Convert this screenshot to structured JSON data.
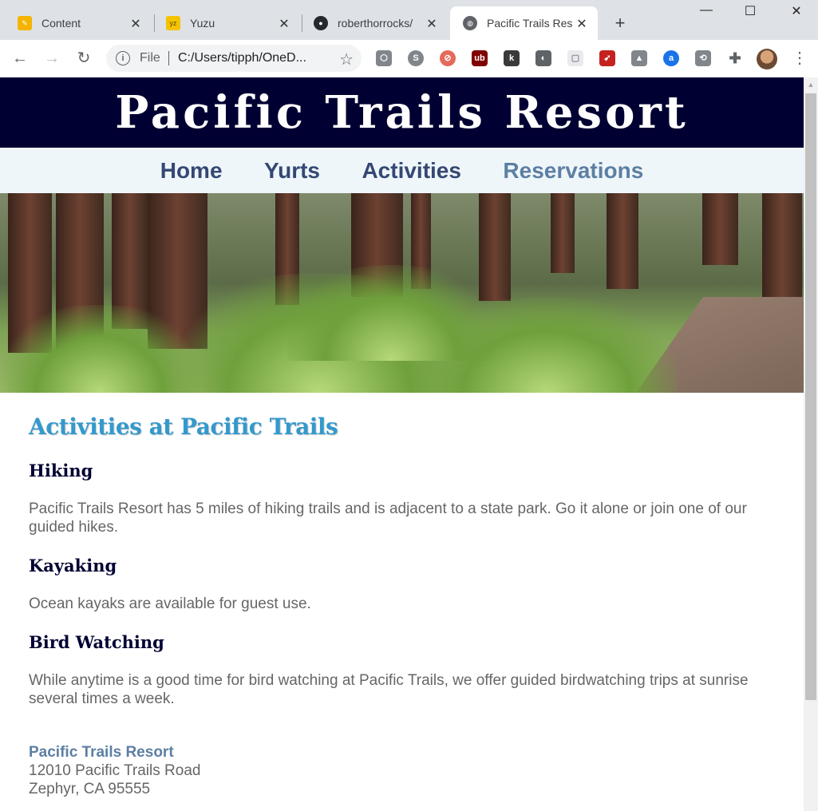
{
  "browser": {
    "tabs": [
      {
        "title": "Content",
        "favicon": "pencil-icon"
      },
      {
        "title": "Yuzu",
        "favicon": "yuzu-icon"
      },
      {
        "title": "roberthorrocks/",
        "favicon": "github-icon"
      },
      {
        "title": "Pacific Trails Res",
        "favicon": "globe-icon",
        "active": true
      }
    ],
    "omnibox": {
      "scheme_label": "File",
      "url": "C:/Users/tipph/OneD..."
    }
  },
  "site": {
    "title": "Pacific Trails Resort",
    "nav": [
      "Home",
      "Yurts",
      "Activities",
      "Reservations"
    ],
    "nav_current_index": 3
  },
  "main": {
    "heading": "Activities at Pacific Trails",
    "sections": [
      {
        "title": "Hiking",
        "text": "Pacific Trails Resort has 5 miles of hiking trails and is adjacent to a state park. Go it alone or join one of our guided hikes."
      },
      {
        "title": "Kayaking",
        "text": "Ocean kayaks are available for guest use."
      },
      {
        "title": "Bird Watching",
        "text": "While anytime is a good time for bird watching at Pacific Trails, we offer guided birdwatching trips at sunrise several times a week."
      }
    ]
  },
  "footer": {
    "name": "Pacific Trails Resort",
    "street": "12010 Pacific Trails Road",
    "city": "Zephyr, CA 95555"
  },
  "colors": {
    "header_bg": "#000033",
    "nav_bg": "#eff6fa",
    "nav_link": "#344873",
    "nav_current": "#5c7fa3",
    "heading": "#3399cc",
    "subheading": "#000033",
    "text": "#666666"
  }
}
